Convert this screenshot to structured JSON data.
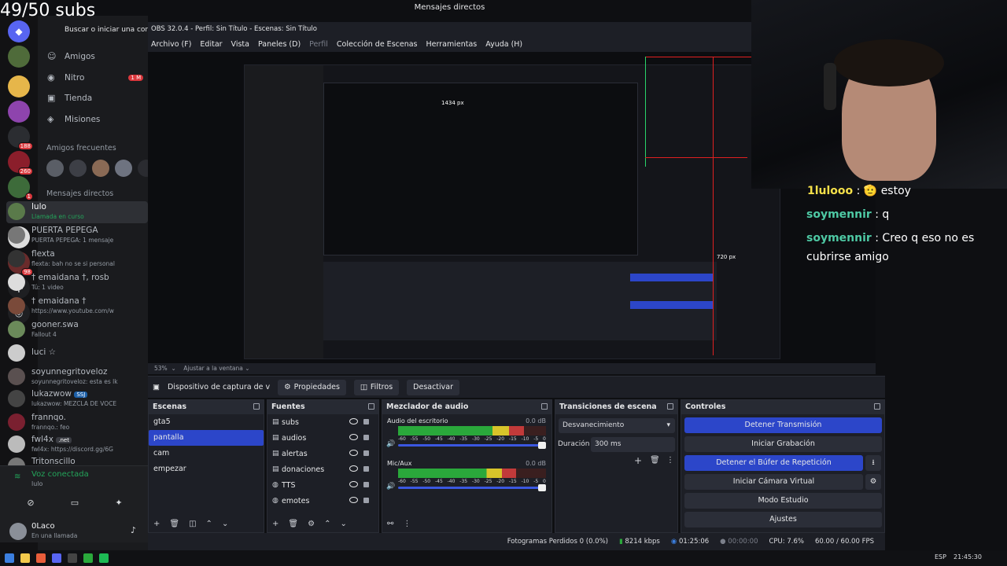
{
  "stream": {
    "subs_goal": "49/50 subs"
  },
  "discord": {
    "top_title": "Mensajes directos",
    "search_placeholder": "Buscar o iniciar una conve",
    "nav": [
      {
        "label": "Amigos",
        "icon": "friends-icon"
      },
      {
        "label": "Nitro",
        "icon": "nitro-icon",
        "badge": "1 M"
      },
      {
        "label": "Tienda",
        "icon": "shop-icon"
      },
      {
        "label": "Misiones",
        "icon": "quests-icon"
      }
    ],
    "favorites_title": "Amigos frecuentes",
    "dm_title": "Mensajes directos",
    "dms": [
      {
        "name": "lulo",
        "sub": "Llamada en curso"
      },
      {
        "name": "PUERTA PEPEGA",
        "sub": "PUERTA PEPEGA: 1 mensaje"
      },
      {
        "name": "flexta",
        "sub": "flexta: bah no se si personal"
      },
      {
        "name": "† emaidana †, rosb",
        "sub": "Tú: 1 video"
      },
      {
        "name": "† emaidana †",
        "sub": "https://www.youtube.com/w"
      },
      {
        "name": "gooner.swa",
        "sub": "Fallout 4"
      },
      {
        "name": "luci ☆",
        "sub": ""
      },
      {
        "name": "soyunnegritoveloz",
        "sub": "soyunnegritoveloz: esta es lk"
      },
      {
        "name": "lukazwow",
        "sub": "lukazwow: MEZCLA DE VOCE",
        "tag": "SSJ"
      },
      {
        "name": "frannqo.",
        "sub": "frannqo.: feo"
      },
      {
        "name": "fwl4x",
        "sub": "fwl4x: https://discord.gg/6G",
        "tag": ".net"
      },
      {
        "name": "Tritonscillo",
        "sub": ""
      }
    ],
    "server_badges": [
      "188",
      "260",
      "1",
      "98"
    ],
    "voice": {
      "status": "Voz conectada",
      "channel": "lulo"
    },
    "user": {
      "name": "0Laco",
      "status": "En una llamada"
    }
  },
  "obs": {
    "title": "OBS 32.0.4 - Perfil: Sin Título - Escenas: Sin Título",
    "menu": [
      "Archivo (F)",
      "Editar",
      "Vista",
      "Paneles (D)",
      "Perfil",
      "Colección de Escenas",
      "Herramientas",
      "Ayuda (H)"
    ],
    "zoom": "53%",
    "fit_label": "Ajustar a la ventana",
    "source_name": "Dispositivo de captura de v",
    "properties_label": "Propiedades",
    "filters_label": "Filtros",
    "deactivate_label": "Desactivar",
    "scenes": {
      "title": "Escenas",
      "items": [
        "gta5",
        "pantalla",
        "cam",
        "empezar"
      ],
      "selected": 1
    },
    "sources": {
      "title": "Fuentes",
      "items": [
        "subs",
        "audios",
        "alertas",
        "donaciones",
        "TTS",
        "emotes"
      ]
    },
    "mixer": {
      "title": "Mezclador de audio",
      "channels": [
        {
          "name": "Audio del escritorio",
          "db": "0.0 dB",
          "level": 0.85
        },
        {
          "name": "Mic/Aux",
          "db": "0.0 dB",
          "level": 0.8
        }
      ],
      "ticks": [
        "-60",
        "-55",
        "-50",
        "-45",
        "-40",
        "-35",
        "-30",
        "-25",
        "-20",
        "-15",
        "-10",
        "-5",
        "0"
      ]
    },
    "transitions": {
      "title": "Transiciones de escena",
      "type": "Desvanecimiento",
      "duration_label": "Duración",
      "duration": "300 ms"
    },
    "controls": {
      "title": "Controles",
      "buttons": [
        "Detener Transmisión",
        "Iniciar Grabación",
        "Detener el Búfer de Repetición",
        "Iniciar Cámara Virtual",
        "Modo Estudio",
        "Ajustes"
      ]
    },
    "preview_labels": {
      "width": "1434 px",
      "height": "720 px"
    },
    "status": {
      "dropped": "Fotogramas Perdidos 0 (0.0%)",
      "bitrate": "8214 kbps",
      "stream_time": "01:25:06",
      "rec_time": "00:00:00",
      "cpu": "CPU: 7.6%",
      "fps": "60.00 / 60.00 FPS"
    }
  },
  "chat": [
    {
      "user": "1lulooo",
      "msg": "estoy",
      "emoji": "🫡"
    },
    {
      "user": "soymennir",
      "msg": "q"
    },
    {
      "user": "soymennir",
      "msg": "Creo q eso no es cubrirse amigo"
    }
  ],
  "taskbar": {
    "lang": "ESP",
    "time": "21:45:30"
  },
  "colors": {
    "obs_blue": "#2c46c9",
    "discord_green": "#23a55a",
    "chat_user": "#4ec9a4"
  }
}
